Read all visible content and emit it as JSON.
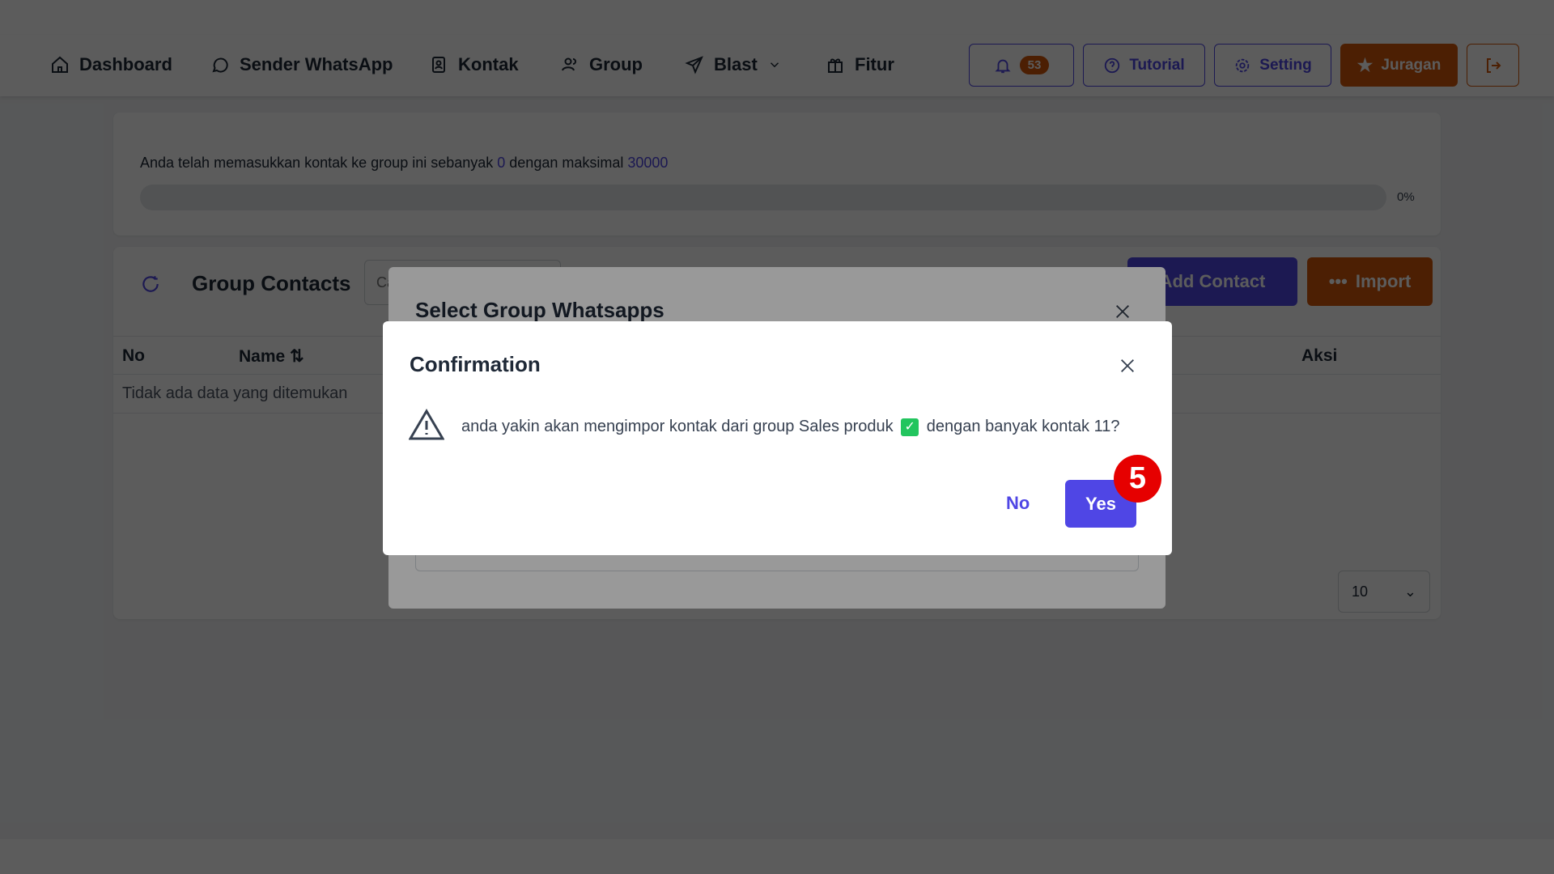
{
  "nav": {
    "items": [
      {
        "label": "Dashboard",
        "icon": "home-icon"
      },
      {
        "label": "Sender WhatsApp",
        "icon": "whatsapp-icon"
      },
      {
        "label": "Kontak",
        "icon": "contact-book-icon"
      },
      {
        "label": "Group",
        "icon": "users-icon"
      },
      {
        "label": "Blast",
        "icon": "send-icon"
      },
      {
        "label": "Fitur",
        "icon": "gift-icon"
      }
    ],
    "notification_count": "53",
    "tutorial": "Tutorial",
    "setting": "Setting",
    "juragan": "Juragan"
  },
  "quota": {
    "text_before": "Anda telah memasukkan kontak ke group ini sebanyak ",
    "count": "0",
    "text_mid": " dengan maksimal ",
    "max": "30000",
    "percent_label": "0%",
    "progress": 0
  },
  "contacts": {
    "title": "Group Contacts",
    "search_placeholder": "Cari",
    "add_contact": "Add Contact",
    "import": "Import",
    "columns": [
      "No",
      "Name",
      "Aksi"
    ],
    "empty": "Tidak ada data yang ditemukan",
    "page_size": "10"
  },
  "select_modal": {
    "title": "Select Group Whatsapps"
  },
  "confirm": {
    "title": "Confirmation",
    "message_before": "anda yakin akan mengimpor kontak dari group Sales produk ",
    "message_after": " dengan banyak kontak 11?",
    "no": "No",
    "yes": "Yes",
    "step_marker": "5"
  },
  "colors": {
    "primary": "#4f46e5",
    "accent": "#d4580a",
    "marker": "#e60000",
    "check": "#22c55e"
  }
}
